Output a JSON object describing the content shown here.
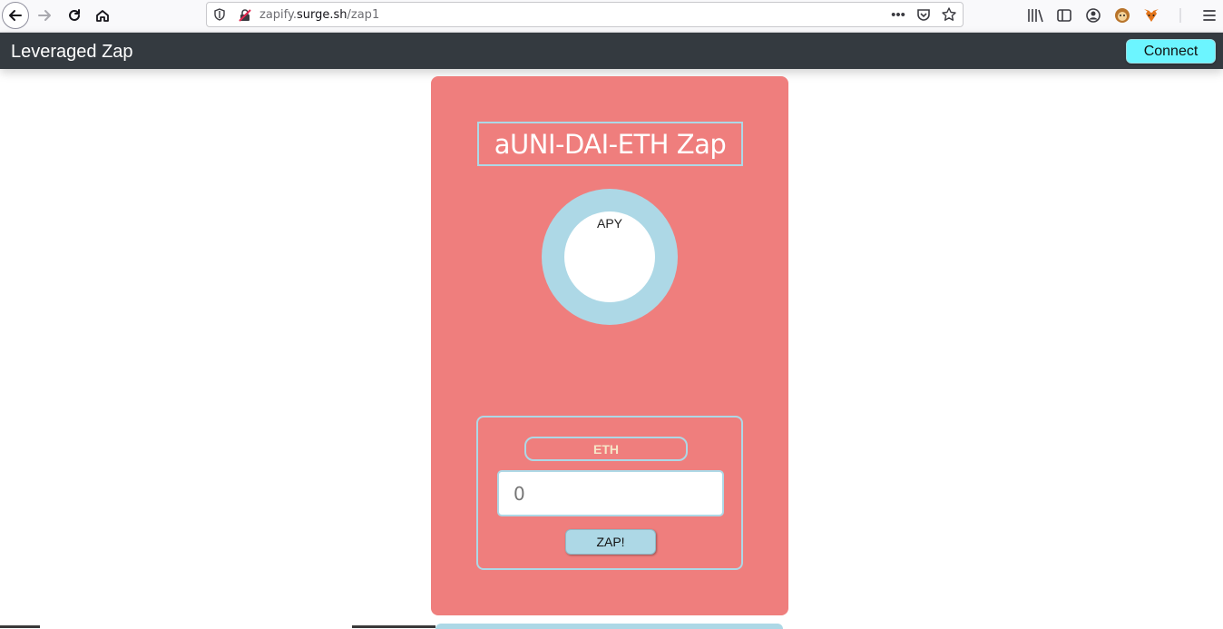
{
  "browser": {
    "url_prefix": "zapify.",
    "url_host": "surge.sh",
    "url_path": "/zap1",
    "page_actions_label": "•••"
  },
  "navbar": {
    "title": "Leveraged Zap",
    "connect_label": "Connect"
  },
  "card": {
    "title": "aUNI-DAI-ETH Zap",
    "apy_label": "APY",
    "token_label": "ETH",
    "amount_placeholder": "0",
    "zap_label": "ZAP!"
  },
  "colors": {
    "navbar_bg": "#343a40",
    "card_bg": "#ef7e7d",
    "accent": "#add8e6",
    "connect_bg": "#6cf5ff"
  }
}
